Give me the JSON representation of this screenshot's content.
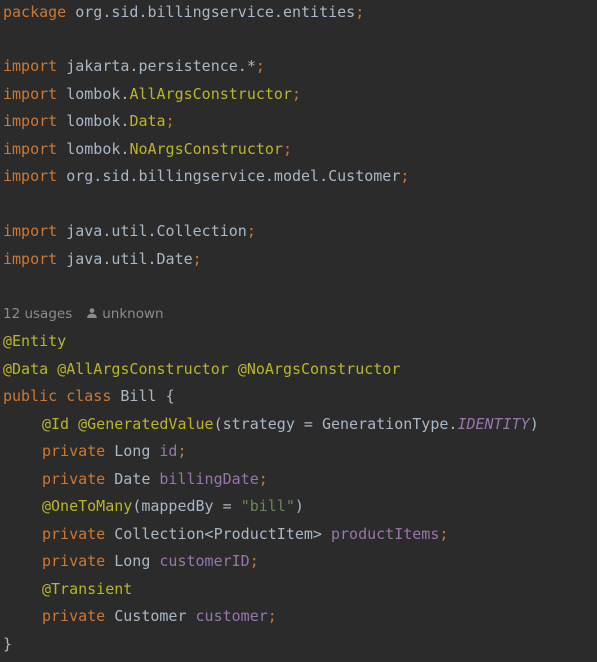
{
  "code": {
    "package_kw": "package",
    "package_name": "org.sid.billingservice.entities",
    "import_kw": "import",
    "imports": [
      {
        "pre": "jakarta.persistence.*",
        "hl": ""
      },
      {
        "pre": "lombok.",
        "hl": "AllArgsConstructor"
      },
      {
        "pre": "lombok.",
        "hl": "Data"
      },
      {
        "pre": "lombok.",
        "hl": "NoArgsConstructor"
      },
      {
        "pre": "org.sid.billingservice.model.Customer",
        "hl": ""
      },
      {
        "pre": "java.util.Collection",
        "hl": ""
      },
      {
        "pre": "java.util.Date",
        "hl": ""
      }
    ],
    "semicolon": ";",
    "hint": {
      "usages": "12 usages",
      "author": "unknown",
      "author_icon": "user-icon"
    },
    "ann_entity": "@Entity",
    "ann_data": "@Data",
    "ann_allargs": "@AllArgsConstructor",
    "ann_noargs": "@NoArgsConstructor",
    "kw_public": "public",
    "kw_class": "class",
    "class_name": "Bill",
    "open_brace": "{",
    "close_brace": "}",
    "ann_id": "@Id",
    "ann_generated": "@GeneratedValue",
    "strategy_args": "(strategy = GenerationType.",
    "identity": "IDENTITY",
    "close_paren": ")",
    "kw_private": "private",
    "type_long": "Long",
    "field_id": "id",
    "type_date": "Date",
    "field_billing_date": "billingDate",
    "ann_onetomany": "@OneToMany",
    "mapped_by": "(mappedBy = ",
    "bill_str": "\"bill\"",
    "type_collection": "Collection<ProductItem>",
    "field_product_items": "productItems",
    "field_customer_id": "customerID",
    "ann_transient": "@Transient",
    "type_customer": "Customer",
    "field_customer": "customer"
  },
  "colors": {
    "background": "#2b2b2b",
    "keyword": "#cc7832",
    "annotation": "#bbb529",
    "field": "#9876aa",
    "string": "#6a8759",
    "text": "#a9b7c6",
    "hint": "#8c8c8c"
  }
}
